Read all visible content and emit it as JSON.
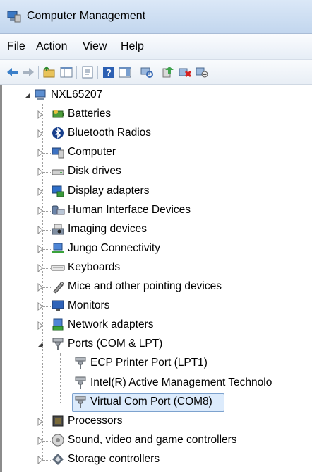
{
  "window": {
    "title": "Computer Management"
  },
  "menu": [
    "File",
    "Action",
    "View",
    "Help"
  ],
  "toolbar": [
    "back-arrow-icon",
    "forward-arrow-icon",
    "folder-up-icon",
    "show-hide-console-tree-icon",
    "properties-icon",
    "help-icon",
    "show-hide-action-pane-icon",
    "scan-hardware-icon",
    "update-driver-icon",
    "uninstall-device-icon",
    "disable-device-icon"
  ],
  "tree": {
    "root": {
      "label": "NXL65207",
      "expanded": true
    },
    "items": [
      {
        "label": "Batteries",
        "icon": "battery-icon",
        "expanded": false
      },
      {
        "label": "Bluetooth Radios",
        "icon": "bluetooth-icon",
        "expanded": false
      },
      {
        "label": "Computer",
        "icon": "computer-icon",
        "expanded": false
      },
      {
        "label": "Disk drives",
        "icon": "disk-drive-icon",
        "expanded": false
      },
      {
        "label": "Display adapters",
        "icon": "display-adapter-icon",
        "expanded": false
      },
      {
        "label": "Human Interface Devices",
        "icon": "hid-icon",
        "expanded": false
      },
      {
        "label": "Imaging devices",
        "icon": "imaging-device-icon",
        "expanded": false
      },
      {
        "label": "Jungo Connectivity",
        "icon": "network-device-icon",
        "expanded": false
      },
      {
        "label": "Keyboards",
        "icon": "keyboard-icon",
        "expanded": false
      },
      {
        "label": "Mice and other pointing devices",
        "icon": "mouse-icon",
        "expanded": false
      },
      {
        "label": "Monitors",
        "icon": "monitor-icon",
        "expanded": false
      },
      {
        "label": "Network adapters",
        "icon": "network-adapter-icon",
        "expanded": false
      },
      {
        "label": "Ports (COM & LPT)",
        "icon": "port-icon",
        "expanded": true,
        "children": [
          {
            "label": "ECP Printer Port (LPT1)",
            "icon": "port-icon"
          },
          {
            "label": "Intel(R) Active Management Technolo",
            "icon": "port-icon"
          },
          {
            "label": "Virtual Com Port (COM8)",
            "icon": "port-icon",
            "selected": true
          }
        ]
      },
      {
        "label": "Processors",
        "icon": "processor-icon",
        "expanded": false
      },
      {
        "label": "Sound, video and game controllers",
        "icon": "sound-icon",
        "expanded": false
      },
      {
        "label": "Storage controllers",
        "icon": "storage-controller-icon",
        "expanded": false
      }
    ]
  },
  "colors": {
    "selection_bg": "#dcebfc",
    "selection_border": "#7da2ce",
    "titlebar": "#c2d6ee"
  }
}
